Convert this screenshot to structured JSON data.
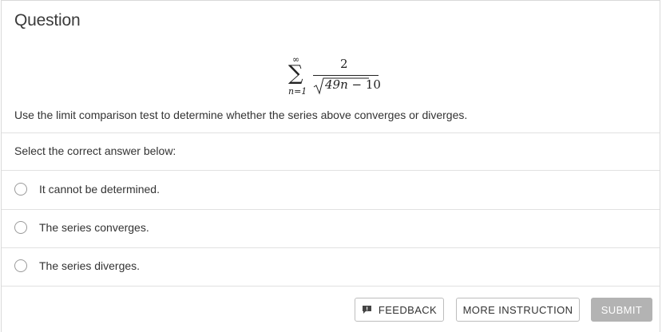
{
  "question": {
    "title": "Question",
    "formula": {
      "sum_upper": "∞",
      "sum_symbol": "∑",
      "sum_lower": "n=1",
      "numerator": "2",
      "denominator_var": "49n",
      "denominator_rest": " − 10"
    },
    "prompt": "Use the limit comparison test to determine whether the series above converges or diverges."
  },
  "answers": {
    "label": "Select the correct answer below:",
    "options": [
      {
        "label": "It cannot be determined.",
        "selected": false
      },
      {
        "label": "The series converges.",
        "selected": false
      },
      {
        "label": "The series diverges.",
        "selected": false
      }
    ]
  },
  "buttons": {
    "feedback": "FEEDBACK",
    "more_instruction": "MORE INSTRUCTION",
    "submit": "SUBMIT"
  },
  "colors": {
    "submit_bg": "#b3b3b3",
    "border": "#d9d9d9",
    "text": "#333333"
  }
}
